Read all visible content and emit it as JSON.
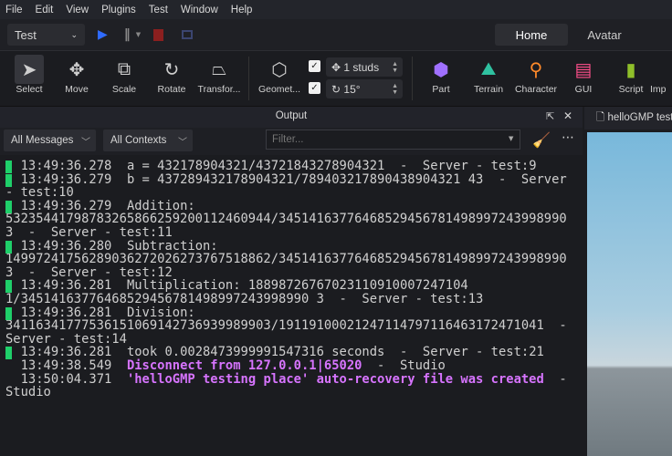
{
  "menu": [
    "File",
    "Edit",
    "View",
    "Plugins",
    "Test",
    "Window",
    "Help"
  ],
  "mode_select": "Test",
  "tabs": {
    "home": "Home",
    "avatar": "Avatar"
  },
  "tools": {
    "select": "Select",
    "move": "Move",
    "scale": "Scale",
    "rotate": "Rotate",
    "transform": "Transfor...",
    "geometry": "Geomet...",
    "part": "Part",
    "terrain": "Terrain",
    "character": "Character",
    "gui": "GUI",
    "script": "Script",
    "import": "Imp"
  },
  "snap": {
    "move": "1 studs",
    "rotate": "15°"
  },
  "output": {
    "title": "Output",
    "messages_filter": "All Messages",
    "contexts_filter": "All Contexts",
    "filter_placeholder": "Filter..."
  },
  "viewport_tab": "helloGMP testing place",
  "log": [
    {
      "time": "13:49:36.278",
      "message": "a = 432178904321/43721843278904321",
      "source": "Server - test:9",
      "type": "server"
    },
    {
      "time": "13:49:36.279",
      "message": "b = 437289432178904321/789403217890438904321 43",
      "source": "Server - test:10",
      "type": "server"
    },
    {
      "time": "13:49:36.279",
      "message": "Addition: 53235441798783265866259200112460944/34514163776468529456781498997243998990 3",
      "source": "Server - test:11",
      "type": "server"
    },
    {
      "time": "13:49:36.280",
      "message": "Subtraction: 14997241756289036272026273767518862/34514163776468529456781498997243998990 3",
      "source": "Server - test:12",
      "type": "server"
    },
    {
      "time": "13:49:36.281",
      "message": "Multiplication: 18898726767023110910007247104 1/34514163776468529456781498997243998990 3",
      "source": "Server - test:13",
      "type": "server"
    },
    {
      "time": "13:49:36.281",
      "message": "Division: 34116341777536151069142736939989903/19119100021247114797116463172471041",
      "source": "Server - test:14",
      "type": "server"
    },
    {
      "time": "13:49:36.281",
      "message": "took 0.0028473999991547316 seconds",
      "source": "Server - test:21",
      "type": "server"
    },
    {
      "time": "13:49:38.549",
      "message": "Disconnect from 127.0.0.1|65020",
      "source": "Studio",
      "type": "studio"
    },
    {
      "time": "13:50:04.371",
      "message": "'helloGMP testing place' auto-recovery file was created",
      "source": "Studio",
      "type": "studio"
    }
  ]
}
